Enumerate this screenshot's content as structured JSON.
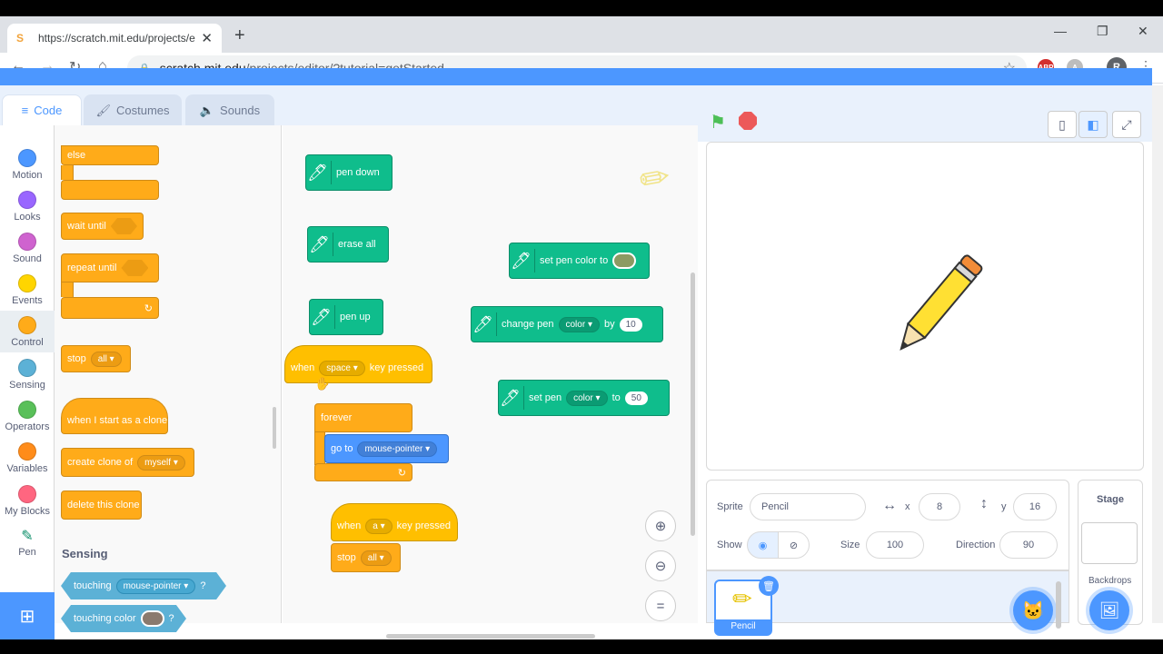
{
  "browser": {
    "tab_title": "https://scratch.mit.edu/projects/e",
    "address": "scratch.mit.edu/projects/editor/?tutorial=getStarted",
    "address_host": "scratch.mit.edu",
    "address_path": "/projects/editor/?tutorial=getStarted",
    "new_tab": "+",
    "profile_initial": "R",
    "ext_abp": "ABP"
  },
  "editor_tabs": [
    {
      "label": "Code"
    },
    {
      "label": "Costumes"
    },
    {
      "label": "Sounds"
    }
  ],
  "categories": [
    {
      "label": "Motion",
      "color": "#4c97ff"
    },
    {
      "label": "Looks",
      "color": "#9966ff"
    },
    {
      "label": "Sound",
      "color": "#cf63cf"
    },
    {
      "label": "Events",
      "color": "#ffd500"
    },
    {
      "label": "Control",
      "color": "#ffab19"
    },
    {
      "label": "Sensing",
      "color": "#5cb1d6"
    },
    {
      "label": "Operators",
      "color": "#59c059"
    },
    {
      "label": "Variables",
      "color": "#ff8c1a"
    },
    {
      "label": "My Blocks",
      "color": "#ff6680"
    },
    {
      "label": "Pen",
      "color": "#0fbd8c"
    }
  ],
  "palette": {
    "else": "else",
    "wait_until": "wait until",
    "repeat_until": "repeat until",
    "stop": "stop",
    "stop_opt": "all",
    "when_clone": "when I start as a clone",
    "create_clone": "create clone of",
    "create_clone_opt": "myself",
    "delete_clone": "delete this clone",
    "sensing_heading": "Sensing",
    "touching": "touching",
    "touching_opt": "mouse-pointer",
    "q": "?",
    "touching_color": "touching color"
  },
  "workspace": {
    "pen_down": "pen down",
    "erase_all": "erase all",
    "pen_up": "pen up",
    "set_pen_color": "set pen color to",
    "change_pen": "change pen",
    "change_pen_opt": "color",
    "by": "by",
    "change_value": "10",
    "set_pen": "set pen",
    "set_pen_opt": "color",
    "to": "to",
    "set_value": "50",
    "when": "when",
    "key_space": "space",
    "key_pressed": "key pressed",
    "forever": "forever",
    "go_to": "go to",
    "go_to_opt": "mouse-pointer",
    "key_a": "a",
    "stop": "stop",
    "stop_opt": "all"
  },
  "sprite": {
    "sprite_label": "Sprite",
    "name": "Pencil",
    "x_label": "x",
    "x": "8",
    "y_label": "y",
    "y": "16",
    "show_label": "Show",
    "size_label": "Size",
    "size": "100",
    "direction_label": "Direction",
    "direction": "90",
    "thumb_name": "Pencil"
  },
  "stage_pane": {
    "title": "Stage",
    "backdrops": "Backdrops"
  },
  "colors": {
    "scratch_blue": "#4c97ff",
    "control": "#ffab19",
    "pen": "#0fbd8c",
    "sensing": "#5cb1d6"
  }
}
